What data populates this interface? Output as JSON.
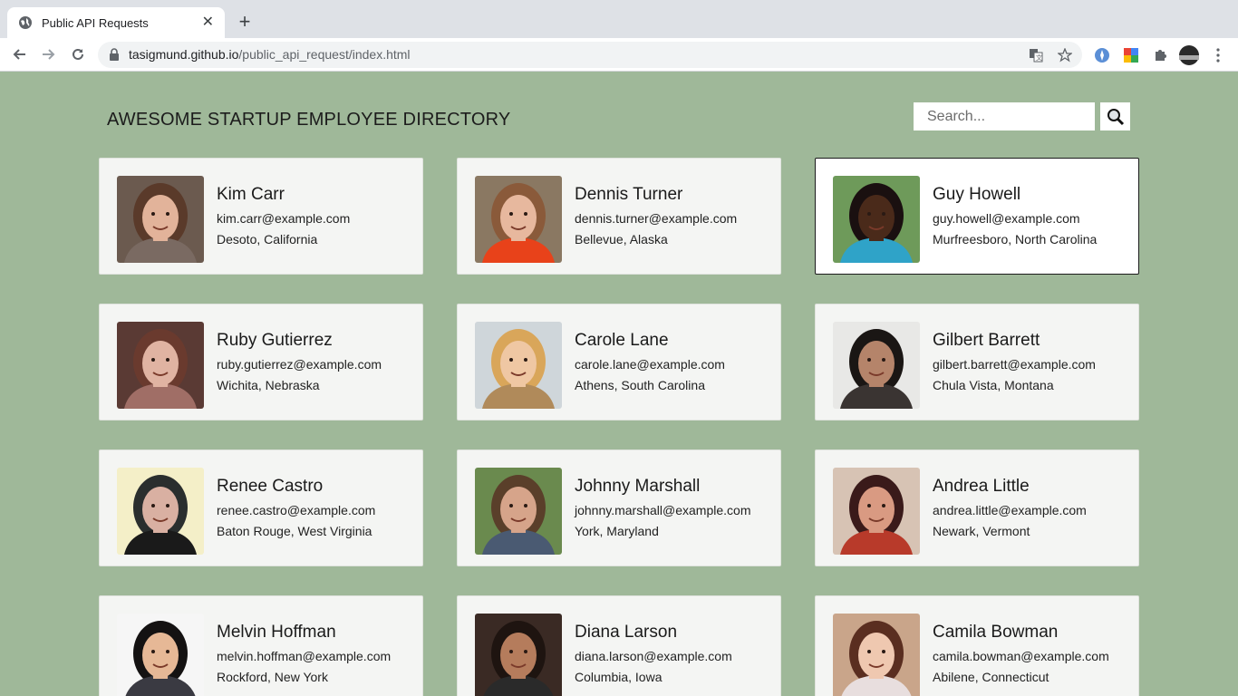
{
  "browser": {
    "tab_title": "Public API Requests",
    "url_domain": "tasigmund.github.io",
    "url_path": "/public_api_request/index.html"
  },
  "header": {
    "title": "AWESOME STARTUP EMPLOYEE DIRECTORY",
    "search_placeholder": "Search..."
  },
  "employees": [
    {
      "name": "Kim Carr",
      "email": "kim.carr@example.com",
      "location": "Desoto, California",
      "bg": "#6b5a4f",
      "skin": "#e2b39a",
      "hair": "#5a3a2a",
      "shirt": "#7a6a62",
      "active": false
    },
    {
      "name": "Dennis Turner",
      "email": "dennis.turner@example.com",
      "location": "Bellevue, Alaska",
      "bg": "#8a7862",
      "skin": "#e7b89e",
      "hair": "#8a5a3a",
      "shirt": "#e8421a",
      "active": false
    },
    {
      "name": "Guy Howell",
      "email": "guy.howell@example.com",
      "location": "Murfreesboro, North Carolina",
      "bg": "#6e9a5a",
      "skin": "#4a2a1a",
      "hair": "#1a1010",
      "shirt": "#2fa3c8",
      "active": true
    },
    {
      "name": "Ruby Gutierrez",
      "email": "ruby.gutierrez@example.com",
      "location": "Wichita, Nebraska",
      "bg": "#5a3a34",
      "skin": "#e0b3a2",
      "hair": "#6a3a2e",
      "shirt": "#a06e66",
      "active": false
    },
    {
      "name": "Carole Lane",
      "email": "carole.lane@example.com",
      "location": "Athens, South Carolina",
      "bg": "#cfd6da",
      "skin": "#efc7a3",
      "hair": "#d9a65a",
      "shirt": "#b08a5a",
      "active": false
    },
    {
      "name": "Gilbert Barrett",
      "email": "gilbert.barrett@example.com",
      "location": "Chula Vista, Montana",
      "bg": "#e8e8e6",
      "skin": "#b5846a",
      "hair": "#1a1614",
      "shirt": "#3a3432",
      "active": false
    },
    {
      "name": "Renee Castro",
      "email": "renee.castro@example.com",
      "location": "Baton Rouge, West Virginia",
      "bg": "#f4efc8",
      "skin": "#d9b0a2",
      "hair": "#2a2e2e",
      "shirt": "#1a1a1a",
      "active": false
    },
    {
      "name": "Johnny Marshall",
      "email": "johnny.marshall@example.com",
      "location": "York, Maryland",
      "bg": "#6a8a4e",
      "skin": "#d6a48a",
      "hair": "#5a3f2a",
      "shirt": "#4a5a72",
      "active": false
    },
    {
      "name": "Andrea Little",
      "email": "andrea.little@example.com",
      "location": "Newark, Vermont",
      "bg": "#d7c3b4",
      "skin": "#d99a82",
      "hair": "#3a1a1a",
      "shirt": "#b83a2a",
      "active": false
    },
    {
      "name": "Melvin Hoffman",
      "email": "melvin.hoffman@example.com",
      "location": "Rockford, New York",
      "bg": "#f6f6f6",
      "skin": "#e6b896",
      "hair": "#141212",
      "shirt": "#3a3a42",
      "active": false
    },
    {
      "name": "Diana Larson",
      "email": "diana.larson@example.com",
      "location": "Columbia, Iowa",
      "bg": "#3a2a24",
      "skin": "#b57c5c",
      "hair": "#1e1410",
      "shirt": "#2a2a2a",
      "active": false
    },
    {
      "name": "Camila Bowman",
      "email": "camila.bowman@example.com",
      "location": "Abilene, Connecticut",
      "bg": "#c9a58a",
      "skin": "#efc8b0",
      "hair": "#5a2e20",
      "shirt": "#e8dede",
      "active": false
    }
  ]
}
